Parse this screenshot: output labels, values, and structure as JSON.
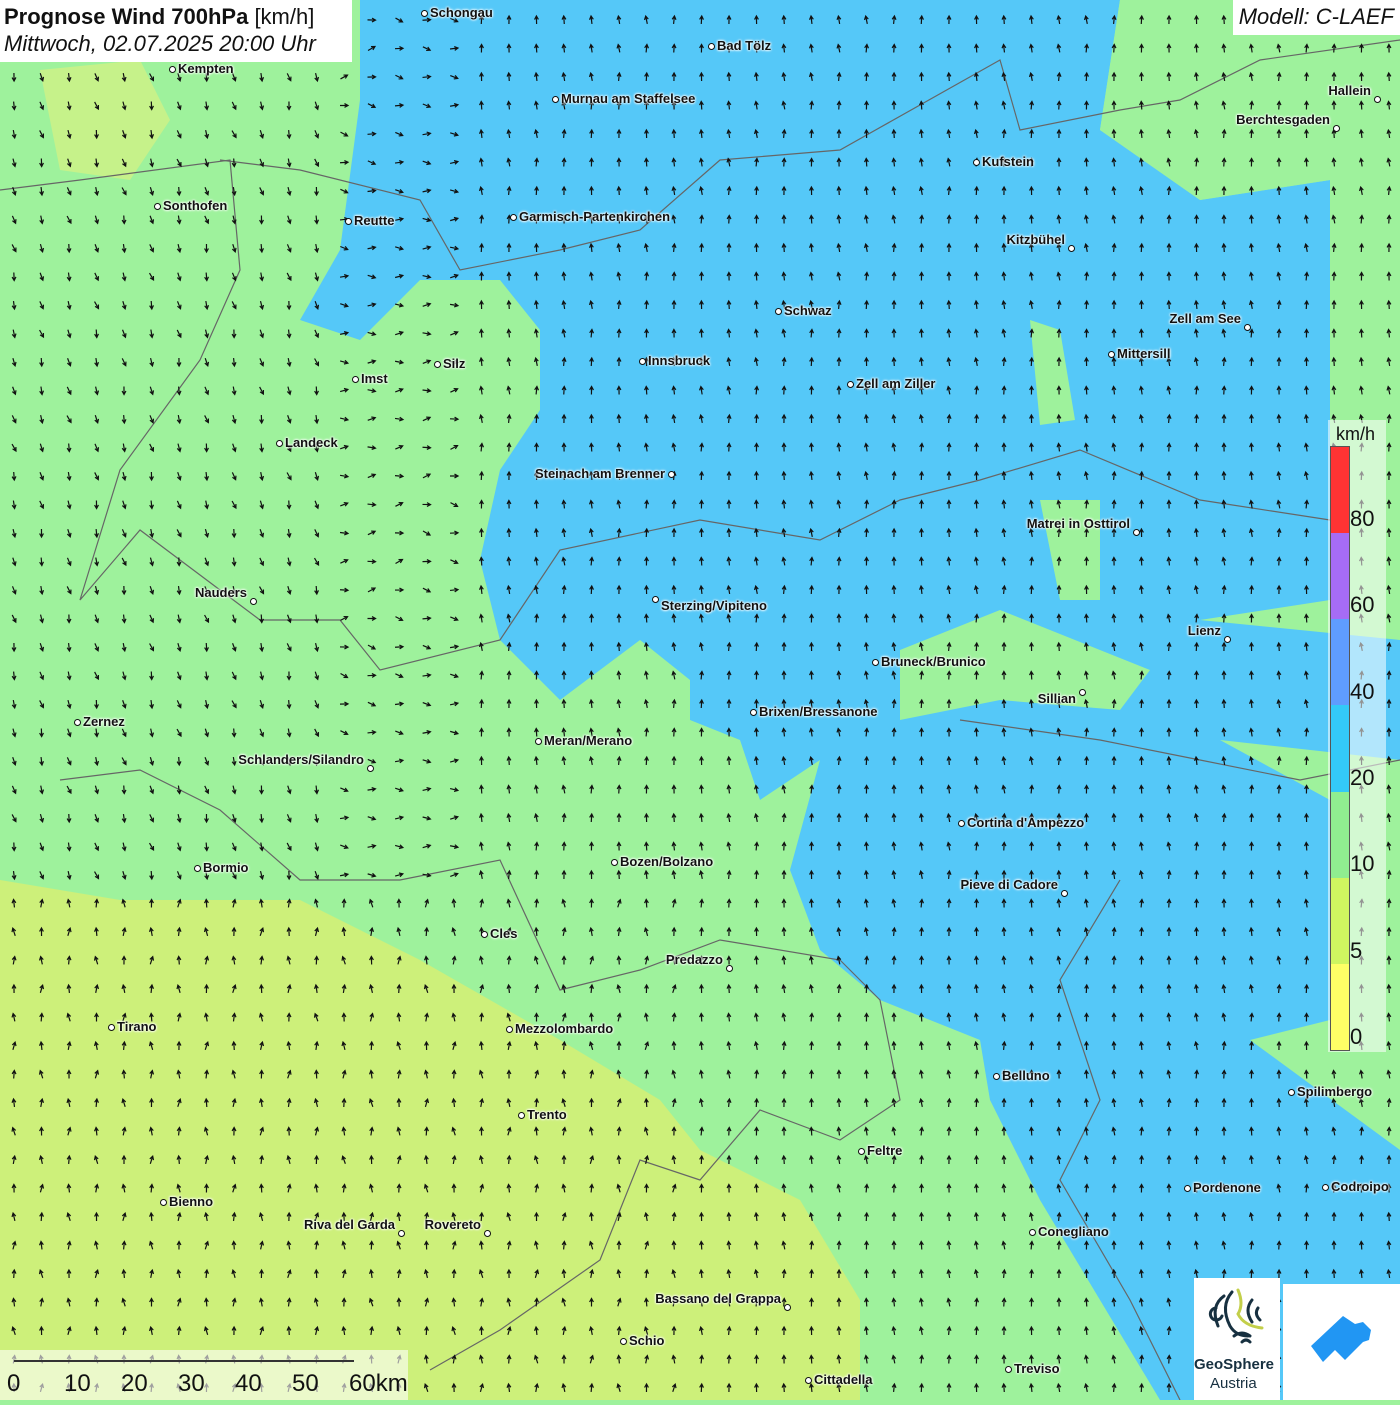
{
  "header": {
    "title_bold": "Prognose Wind 700hPa",
    "title_unit": "[km/h]",
    "datetime": "Mittwoch, 02.07.2025 20:00 Uhr"
  },
  "model": "Modell: C-LAEF",
  "colors": {
    "blue": "#55c8f8",
    "green": "#9ef29c",
    "yellowgreen": "#cdf07a",
    "border": "#666666",
    "arrow": "#111111"
  },
  "legend": {
    "unit": "km/h",
    "labels": [
      "80",
      "60",
      "40",
      "20",
      "10",
      "5",
      "0"
    ],
    "colors": [
      "#ff3333",
      "#a66cf5",
      "#5f9cff",
      "#33c9f8",
      "#90ee90",
      "#cff560",
      "#ffff66"
    ]
  },
  "scale": {
    "labels": [
      "0",
      "10",
      "20",
      "30",
      "40",
      "50",
      "60km"
    ]
  },
  "logos": {
    "geosphere_name": "GeoSphere",
    "geosphere_sub": "Austria",
    "brand_color": "#2196f3"
  },
  "cities": [
    "Schongau",
    "Bad Tölz",
    "Kempten",
    "Murnau am Staffelsee",
    "Hallein",
    "Berchtesgaden",
    "Kufstein",
    "Sonthofen",
    "Reutte",
    "Garmisch-Partenkirchen",
    "Kitzbühel",
    "Schwaz",
    "Zell am See",
    "Mittersill",
    "Innsbruck",
    "Silz",
    "Imst",
    "Zell am Ziller",
    "Landeck",
    "Steinach am Brenner",
    "Matrei in Osttirol",
    "Nauders",
    "Sterzing/Vipiteno",
    "Lienz",
    "Bruneck/Brunico",
    "Sillian",
    "Brixen/Bressanone",
    "Zernez",
    "Meran/Merano",
    "Schlanders/Silandro",
    "Cortina d'Ampezzo",
    "Bozen/Bolzano",
    "Bormio",
    "Pieve di Cadore",
    "Cles",
    "Predazzo",
    "Tirano",
    "Mezzolombardo",
    "Belluno",
    "Spilimbergo",
    "Trento",
    "Feltre",
    "Pordenone",
    "Codroipo",
    "Bienno",
    "Riva del Garda",
    "Rovereto",
    "Conegliano",
    "Bassano del Grappa",
    "Schio",
    "Treviso",
    "Cittadella"
  ]
}
